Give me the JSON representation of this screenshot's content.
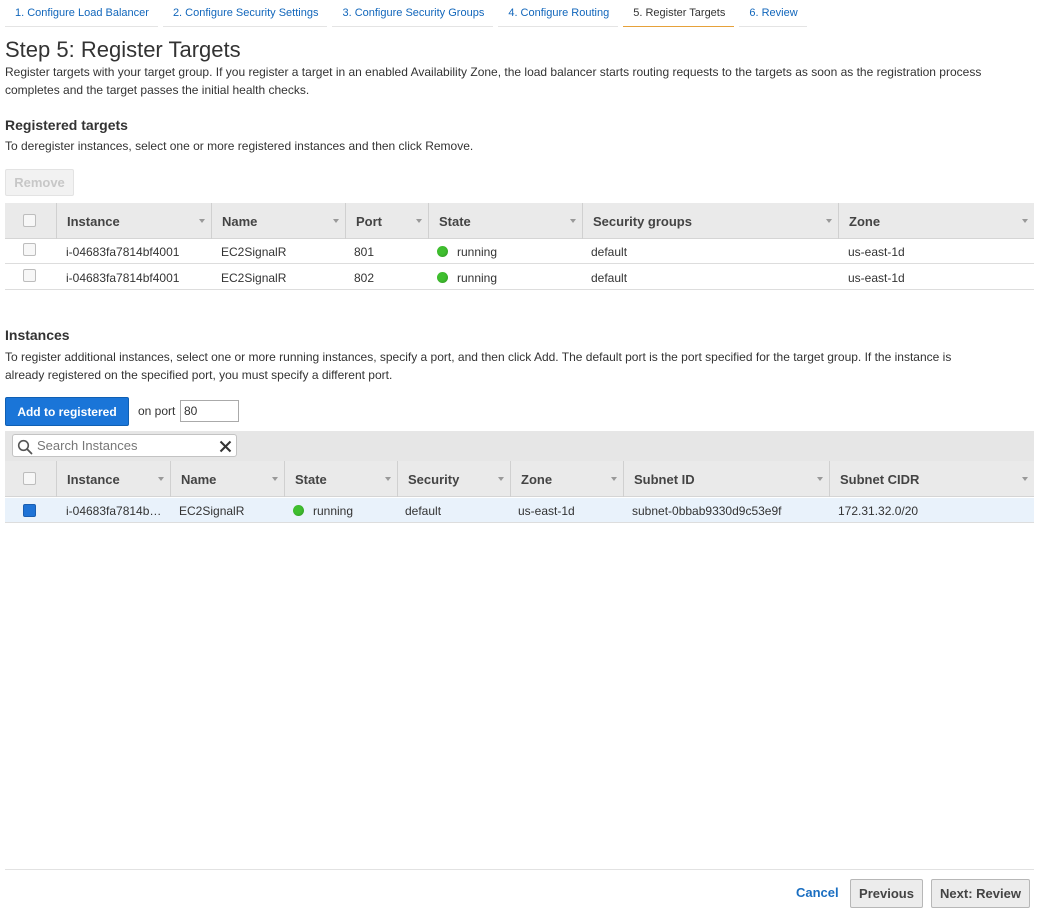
{
  "wizard": {
    "tabs": [
      {
        "label": "1. Configure Load Balancer"
      },
      {
        "label": "2. Configure Security Settings"
      },
      {
        "label": "3. Configure Security Groups"
      },
      {
        "label": "4. Configure Routing"
      },
      {
        "label": "5. Register Targets",
        "active": true
      },
      {
        "label": "6. Review"
      }
    ]
  },
  "page": {
    "title": "Step 5: Register Targets",
    "description_line1": "Register targets with your target group. If you register a target in an enabled Availability Zone, the load balancer starts routing requests to the targets as soon as the registration process",
    "description_line2": "completes and the target passes the initial health checks."
  },
  "registered": {
    "heading": "Registered targets",
    "hint": "To deregister instances, select one or more registered instances and then click Remove.",
    "remove_label": "Remove",
    "columns": [
      "Instance",
      "Name",
      "Port",
      "State",
      "Security groups",
      "Zone"
    ],
    "rows": [
      {
        "instance": "i-04683fa7814bf4001",
        "name": "EC2SignalR",
        "port": "801",
        "state": "running",
        "security_groups": "default",
        "zone": "us-east-1d"
      },
      {
        "instance": "i-04683fa7814bf4001",
        "name": "EC2SignalR",
        "port": "802",
        "state": "running",
        "security_groups": "default",
        "zone": "us-east-1d"
      }
    ]
  },
  "instances": {
    "heading": "Instances",
    "hint_line1": "To register additional instances, select one or more running instances, specify a port, and then click Add. The default port is the port specified for the target group. If the instance is",
    "hint_line2": "already registered on the specified port, you must specify a different port.",
    "add_label": "Add to registered",
    "on_port_label": "on port",
    "port_value": "80",
    "search_placeholder": "Search Instances",
    "columns": [
      "Instance",
      "Name",
      "State",
      "Security",
      "Zone",
      "Subnet ID",
      "Subnet CIDR"
    ],
    "rows": [
      {
        "instance": "i-04683fa7814b…",
        "name": "EC2SignalR",
        "state": "running",
        "security": "default",
        "zone": "us-east-1d",
        "subnet_id": "subnet-0bbab9330d9c53e9f",
        "subnet_cidr": "172.31.32.0/20",
        "selected": true
      }
    ]
  },
  "footer": {
    "cancel_label": "Cancel",
    "previous_label": "Previous",
    "next_label": "Next: Review"
  },
  "colors": {
    "link": "#1166bb",
    "primary": "#1a75d8",
    "active_tab_underline": "#e6a13a",
    "running": "#3fbf2f"
  }
}
